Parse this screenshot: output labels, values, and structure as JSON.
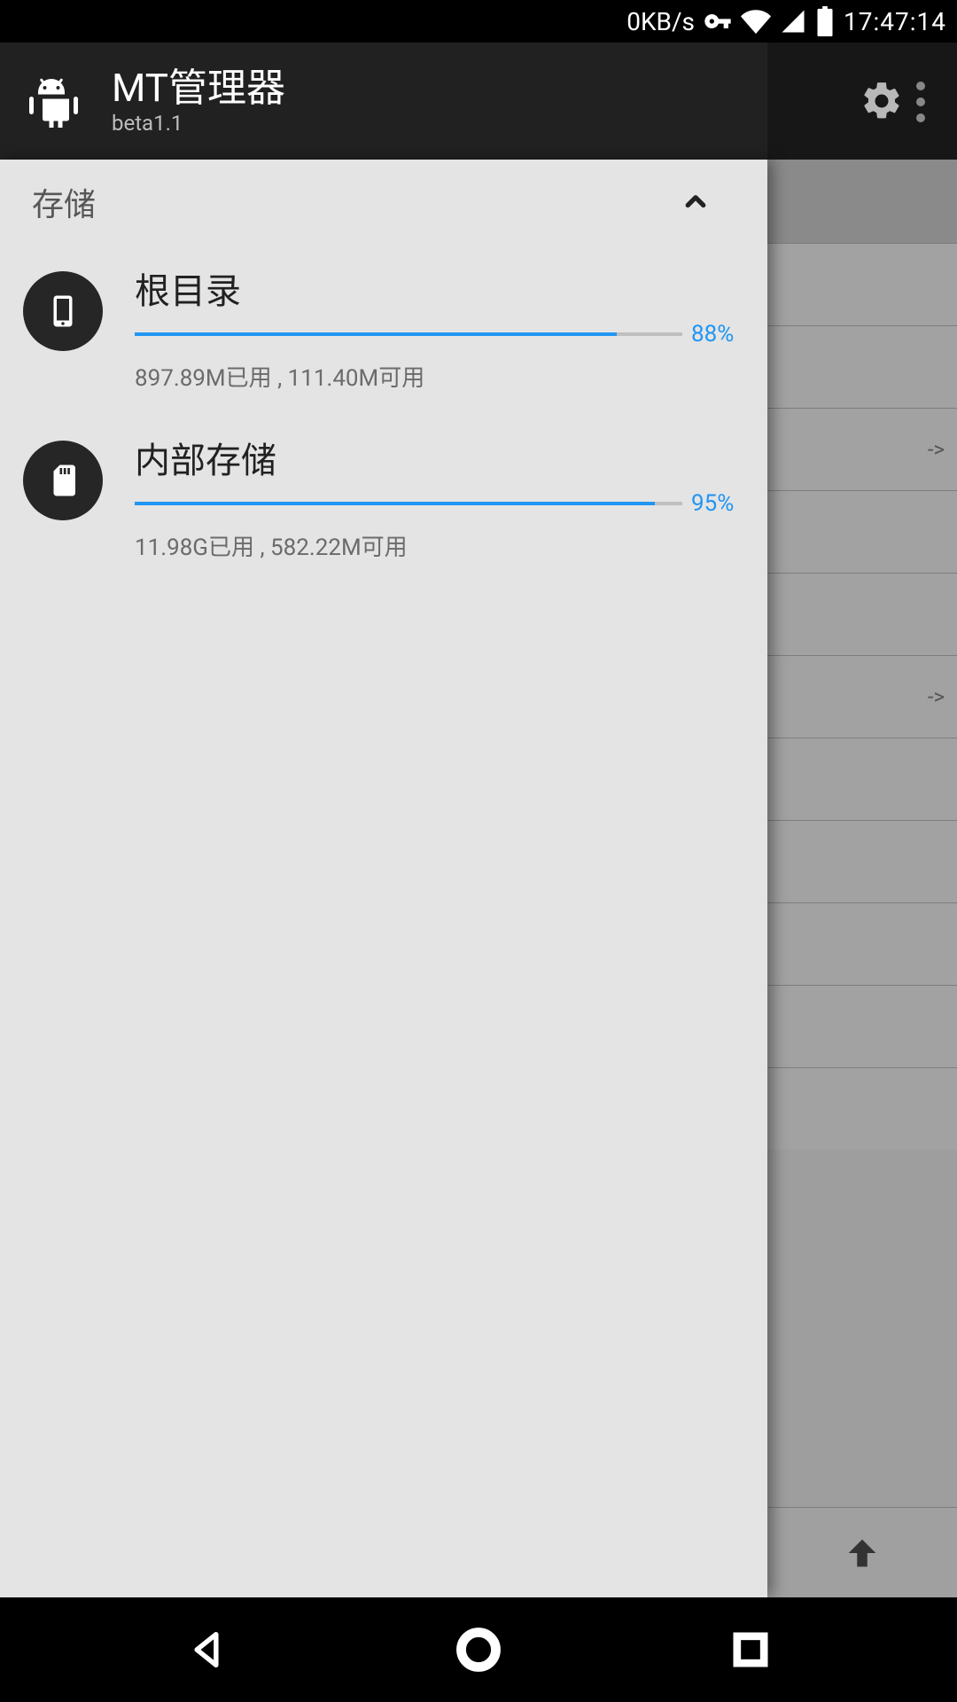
{
  "status": {
    "net_speed": "0KB/s",
    "clock": "17:47:14"
  },
  "app": {
    "title": "MT管理器",
    "subtitle": "beta1.1"
  },
  "drawer": {
    "section_label": "存储",
    "items": [
      {
        "name": "根目录",
        "percent_label": "88%",
        "percent_value": 88,
        "usage": "897.89M已用 , 111.40M可用"
      },
      {
        "name": "内部存储",
        "percent_label": "95%",
        "percent_value": 95,
        "usage": "11.98G已用 , 582.22M可用"
      }
    ]
  },
  "bg_rows": [
    {
      "text": ""
    },
    {
      "text": ""
    },
    {
      "text": "->"
    },
    {
      "text": ""
    },
    {
      "text": ""
    },
    {
      "text": "->"
    },
    {
      "text": ""
    },
    {
      "text": ""
    },
    {
      "text": ""
    },
    {
      "text": ""
    },
    {
      "text": ""
    }
  ]
}
